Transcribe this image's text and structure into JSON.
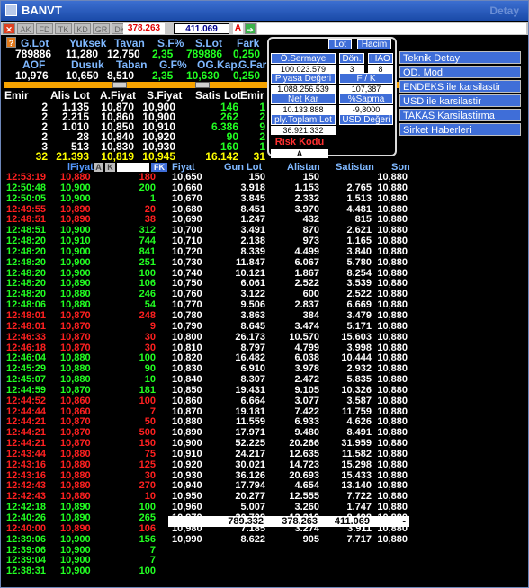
{
  "title": "BANVT",
  "detail": "Detay",
  "toolbar": {
    "buttons": [
      "AK",
      "FD",
      "TK",
      "KD",
      "GR",
      "DK"
    ],
    "field1": "378.263",
    "field2": "411.069",
    "field3": "A"
  },
  "summary": {
    "h1": [
      "G.Lot",
      "Yuksek",
      "Tavan",
      "S.F%",
      "S.Lot",
      "Fark"
    ],
    "v1": [
      "789886",
      "11,280",
      "12,750",
      "2,35",
      "789886",
      "0,250"
    ],
    "h2": [
      "AOF",
      "Dusuk",
      "Taban",
      "G.F%",
      "OG.Kap.",
      "G.Fark"
    ],
    "v2": [
      "10,976",
      "10,650",
      "8,510",
      "2,35",
      "10,630",
      "0,250"
    ]
  },
  "depth": {
    "headers": [
      "Emir",
      "Alis Lot",
      "A.Fiyat",
      "S.Fiyat",
      "Satis Lot",
      "Emir"
    ],
    "rows": [
      [
        "2",
        "1.135",
        "10,870",
        "10,900",
        "146",
        "1"
      ],
      [
        "2",
        "2.215",
        "10,860",
        "10,900",
        "262",
        "2"
      ],
      [
        "2",
        "1.010",
        "10,850",
        "10,910",
        "6.386",
        "9"
      ],
      [
        "2",
        "28",
        "10,840",
        "10,920",
        "90",
        "2"
      ],
      [
        "3",
        "513",
        "10,830",
        "10,930",
        "160",
        "1"
      ],
      [
        "32",
        "21.393",
        "10,819",
        "10,945",
        "16.142",
        "31"
      ]
    ]
  },
  "popup": {
    "lot": "Lot",
    "hacim": "Hacim",
    "osermaye": "Ö.Sermaye",
    "osermaye_val": "100.023.579",
    "don": "Dön.",
    "don_val": "3",
    "hao": "HAO",
    "hao_val": "8",
    "piyasa": "Piyasa Değeri",
    "piyasa_val": "1.088.256.539",
    "fk": "F / K",
    "fk_val": "107,387",
    "netkar": "Net Kar",
    "netkar_val": "10.133.888",
    "sapma": "%Sapma",
    "sapma_val": "-9,8000",
    "toplam": "ply.Toplam Lot",
    "toplam_val": "36.921.332",
    "usd": "USD Değeri",
    "risk": "Risk Kodu",
    "risk_val": "A"
  },
  "side": [
    "Teknik Detay",
    "OD. Mod.",
    "ENDEKS ile karsilastir",
    "USD ile karsilastir",
    "TAKAS Karsilastirma",
    "Sirket Haberleri"
  ],
  "trades": {
    "headers": [
      "lFiyat",
      "A",
      "K",
      "FK"
    ],
    "rows": [
      [
        "12:53:19",
        "10,880",
        "180",
        "r"
      ],
      [
        "12:50:48",
        "10,900",
        "200",
        "g"
      ],
      [
        "12:50:05",
        "10,900",
        "1",
        "g"
      ],
      [
        "12:49:55",
        "10,890",
        "20",
        "r"
      ],
      [
        "12:48:51",
        "10,890",
        "38",
        "r"
      ],
      [
        "12:48:51",
        "10,900",
        "312",
        "g"
      ],
      [
        "12:48:20",
        "10,910",
        "744",
        "g"
      ],
      [
        "12:48:20",
        "10,900",
        "841",
        "g"
      ],
      [
        "12:48:20",
        "10,900",
        "251",
        "g"
      ],
      [
        "12:48:20",
        "10,900",
        "100",
        "g"
      ],
      [
        "12:48:20",
        "10,890",
        "106",
        "g"
      ],
      [
        "12:48:20",
        "10,880",
        "246",
        "g"
      ],
      [
        "12:48:06",
        "10,880",
        "54",
        "g"
      ],
      [
        "12:48:01",
        "10,870",
        "248",
        "r"
      ],
      [
        "12:48:01",
        "10,870",
        "9",
        "r"
      ],
      [
        "12:46:33",
        "10,870",
        "30",
        "r"
      ],
      [
        "12:46:18",
        "10,870",
        "30",
        "r"
      ],
      [
        "12:46:04",
        "10,880",
        "100",
        "g"
      ],
      [
        "12:45:29",
        "10,880",
        "90",
        "g"
      ],
      [
        "12:45:07",
        "10,880",
        "10",
        "g"
      ],
      [
        "12:44:59",
        "10,870",
        "181",
        "g"
      ],
      [
        "12:44:52",
        "10,860",
        "100",
        "r"
      ],
      [
        "12:44:44",
        "10,860",
        "7",
        "r"
      ],
      [
        "12:44:21",
        "10,870",
        "50",
        "r"
      ],
      [
        "12:44:21",
        "10,870",
        "500",
        "r"
      ],
      [
        "12:44:21",
        "10,870",
        "150",
        "r"
      ],
      [
        "12:43:44",
        "10,880",
        "75",
        "r"
      ],
      [
        "12:43:16",
        "10,880",
        "125",
        "r"
      ],
      [
        "12:43:16",
        "10,880",
        "30",
        "r"
      ],
      [
        "12:42:43",
        "10,880",
        "270",
        "r"
      ],
      [
        "12:42:43",
        "10,880",
        "10",
        "r"
      ],
      [
        "12:42:18",
        "10,890",
        "100",
        "g"
      ],
      [
        "12:40:26",
        "10,890",
        "265",
        "g"
      ],
      [
        "12:40:00",
        "10,890",
        "106",
        "r"
      ],
      [
        "12:39:06",
        "10,900",
        "156",
        "g"
      ],
      [
        "12:39:06",
        "10,900",
        "7",
        "g"
      ],
      [
        "12:39:04",
        "10,900",
        "7",
        "g"
      ],
      [
        "12:38:31",
        "10,900",
        "100",
        "g"
      ]
    ]
  },
  "prices": {
    "headers": [
      "Fiyat",
      "Gun Lot",
      "Alistan",
      "Satistan",
      "Son"
    ],
    "rows": [
      [
        "10,650",
        "150",
        "150",
        "",
        "10,880"
      ],
      [
        "10,660",
        "3.918",
        "1.153",
        "2.765",
        "10,880"
      ],
      [
        "10,670",
        "3.845",
        "2.332",
        "1.513",
        "10,880"
      ],
      [
        "10,680",
        "8.451",
        "3.970",
        "4.481",
        "10,880"
      ],
      [
        "10,690",
        "1.247",
        "432",
        "815",
        "10,880"
      ],
      [
        "10,700",
        "3.491",
        "870",
        "2.621",
        "10,880"
      ],
      [
        "10,710",
        "2.138",
        "973",
        "1.165",
        "10,880"
      ],
      [
        "10,720",
        "8.339",
        "4.499",
        "3.840",
        "10,880"
      ],
      [
        "10,730",
        "11.847",
        "6.067",
        "5.780",
        "10,880"
      ],
      [
        "10,740",
        "10.121",
        "1.867",
        "8.254",
        "10,880"
      ],
      [
        "10,750",
        "6.061",
        "2.522",
        "3.539",
        "10,880"
      ],
      [
        "10,760",
        "3.122",
        "600",
        "2.522",
        "10,880"
      ],
      [
        "10,770",
        "9.506",
        "2.837",
        "6.669",
        "10,880"
      ],
      [
        "10,780",
        "3.863",
        "384",
        "3.479",
        "10,880"
      ],
      [
        "10,790",
        "8.645",
        "3.474",
        "5.171",
        "10,880"
      ],
      [
        "10,800",
        "26.173",
        "10.570",
        "15.603",
        "10,880"
      ],
      [
        "10,810",
        "8.797",
        "4.799",
        "3.998",
        "10,880"
      ],
      [
        "10,820",
        "16.482",
        "6.038",
        "10.444",
        "10,880"
      ],
      [
        "10,830",
        "6.910",
        "3.978",
        "2.932",
        "10,880"
      ],
      [
        "10,840",
        "8.307",
        "2.472",
        "5.835",
        "10,880"
      ],
      [
        "10,850",
        "19.431",
        "9.105",
        "10.326",
        "10,880"
      ],
      [
        "10,860",
        "6.664",
        "3.077",
        "3.587",
        "10,880"
      ],
      [
        "10,870",
        "19.181",
        "7.422",
        "11.759",
        "10,880"
      ],
      [
        "10,880",
        "11.559",
        "6.933",
        "4.626",
        "10,880"
      ],
      [
        "10,890",
        "17.971",
        "9.480",
        "8.491",
        "10,880"
      ],
      [
        "10,900",
        "52.225",
        "20.266",
        "31.959",
        "10,880"
      ],
      [
        "10,910",
        "24.217",
        "12.635",
        "11.582",
        "10,880"
      ],
      [
        "10,920",
        "30.021",
        "14.723",
        "15.298",
        "10,880"
      ],
      [
        "10,930",
        "36.126",
        "20.693",
        "15.433",
        "10,880"
      ],
      [
        "10,940",
        "17.794",
        "4.654",
        "13.140",
        "10,880"
      ],
      [
        "10,950",
        "20.277",
        "12.555",
        "7.722",
        "10,880"
      ],
      [
        "10,960",
        "5.007",
        "3.260",
        "1.747",
        "10,880"
      ],
      [
        "10,970",
        "20.708",
        "12.210",
        "8.498",
        "10,880"
      ],
      [
        "10,980",
        "7.185",
        "3.274",
        "3.911",
        "10,880"
      ],
      [
        "10,990",
        "8.622",
        "905",
        "7.717",
        "10,880"
      ]
    ],
    "totals": [
      "789.332",
      "378.263",
      "411.069",
      "-"
    ]
  }
}
